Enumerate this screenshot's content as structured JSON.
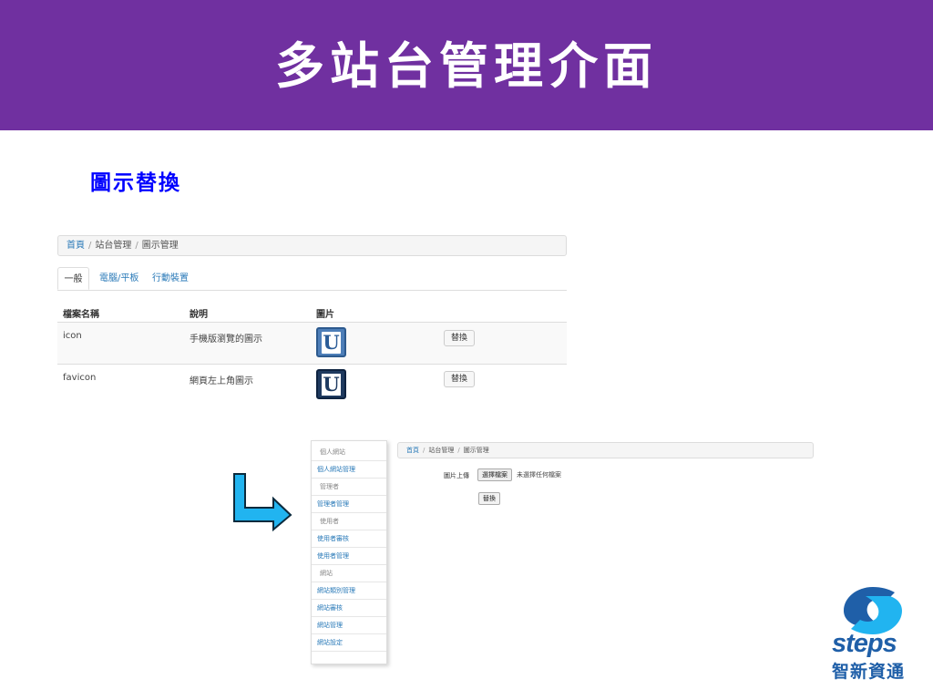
{
  "slide": {
    "title": "多站台管理介面",
    "subtitle": "圖示替換",
    "colors": {
      "banner": "#7030A0",
      "subtitle": "#0000ff",
      "link": "#2a7ab8",
      "arrow": "#21b4f0"
    }
  },
  "shot1": {
    "breadcrumb": {
      "home": "首頁",
      "section": "站台管理",
      "current": "圖示管理"
    },
    "tabs": [
      {
        "label": "一般",
        "active": true
      },
      {
        "label": "電腦/平板",
        "active": false
      },
      {
        "label": "行動裝置",
        "active": false
      }
    ],
    "columns": [
      "檔案名稱",
      "說明",
      "圖片"
    ],
    "rows": [
      {
        "name": "icon",
        "desc": "手機版瀏覽的圖示",
        "image_letter": "U",
        "action": "替換"
      },
      {
        "name": "favicon",
        "desc": "網頁左上角圖示",
        "image_letter": "U",
        "action": "替換"
      }
    ]
  },
  "shot2": {
    "sidebar": [
      {
        "label": "個人網站",
        "type": "header"
      },
      {
        "label": "個人網站管理",
        "type": "link"
      },
      {
        "label": "管理者",
        "type": "header"
      },
      {
        "label": "管理者管理",
        "type": "link"
      },
      {
        "label": "使用者",
        "type": "header"
      },
      {
        "label": "使用者審核",
        "type": "link"
      },
      {
        "label": "使用者管理",
        "type": "link"
      },
      {
        "label": "網站",
        "type": "header"
      },
      {
        "label": "網站類別管理",
        "type": "link"
      },
      {
        "label": "網站審核",
        "type": "link"
      },
      {
        "label": "網站管理",
        "type": "link"
      },
      {
        "label": "網站設定",
        "type": "link"
      }
    ],
    "breadcrumb": {
      "home": "首頁",
      "section": "站台管理",
      "current": "圖示管理"
    },
    "upload_label": "圖片上傳",
    "choose_file": "選擇檔案",
    "no_file": "未選擇任何檔案",
    "submit": "替換"
  },
  "logo": {
    "word": "steps",
    "chinese": "智新資通"
  }
}
